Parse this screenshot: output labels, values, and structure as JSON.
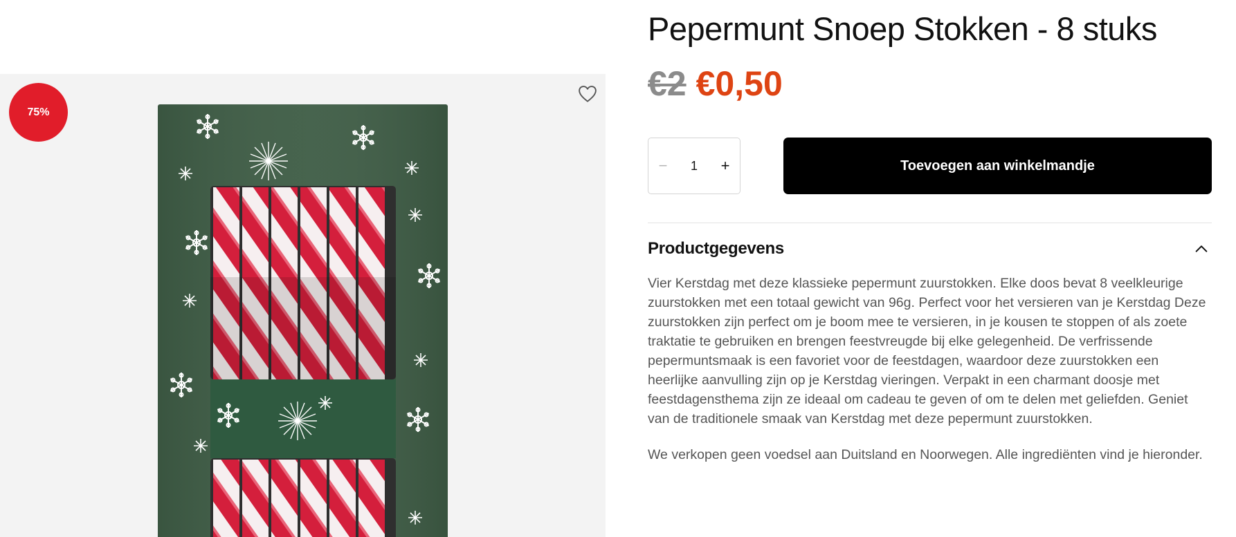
{
  "product": {
    "title": "Pepermunt Snoep Stokken - 8 stuks",
    "old_price": "€2",
    "new_price": "€0,50",
    "discount_badge": "75%"
  },
  "quantity": {
    "value": "1",
    "minus_label": "−",
    "plus_label": "+"
  },
  "cart": {
    "add_label": "Toevoegen aan winkelmandje"
  },
  "details": {
    "heading": "Productgegevens",
    "expanded": true,
    "description": "Vier Kerstdag met deze klassieke pepermunt zuurstokken. Elke doos bevat 8 veelkleurige zuurstokken met een totaal gewicht van 96g. Perfect voor het versieren van je Kerstdag Deze zuurstokken zijn perfect om je boom mee te versieren, in je kousen te stoppen of als zoete traktatie te gebruiken en brengen feestvreugde bij elke gelegenheid. De verfrissende pepermuntsmaak is een favoriet voor de feestdagen, waardoor deze zuurstokken een heerlijke aanvulling zijn op je Kerstdag vieringen. Verpakt in een charmant doosje met feestdagensthema zijn ze ideaal om cadeau te geven of om te delen met geliefden. Geniet van de traditionele smaak van Kerstdag met deze pepermunt zuurstokken.",
    "notice": "We verkopen geen voedsel aan Duitsland en Noorwegen. Alle ingrediënten vind je hieronder."
  },
  "icons": {
    "wishlist": "heart-outline-icon",
    "accordion_toggle": "chevron-up-icon"
  },
  "colors": {
    "sale_price": "#de4413",
    "old_price": "#8b8b8b",
    "badge": "#e11d2a",
    "cta_background": "#000000",
    "package_green": "#3f5d46",
    "candy_red": "#d41f3c"
  }
}
